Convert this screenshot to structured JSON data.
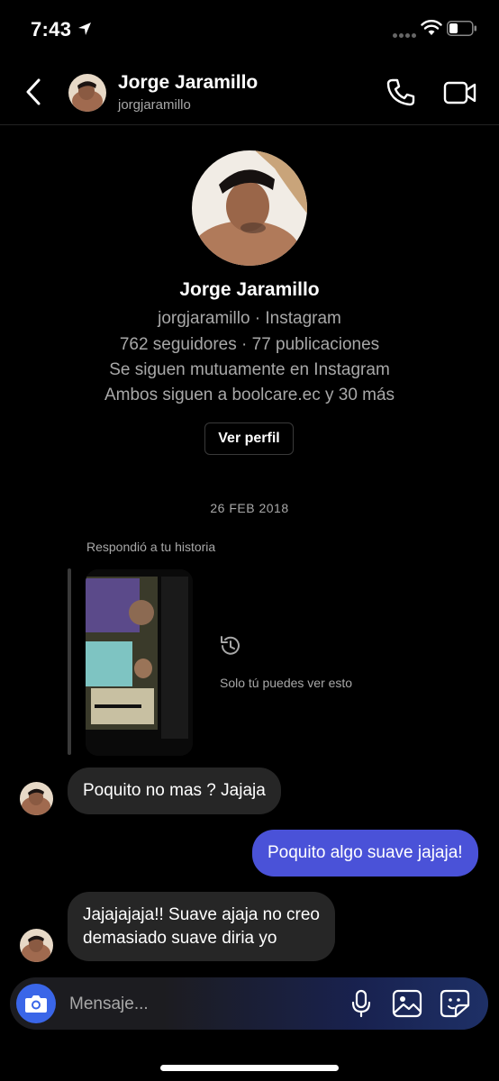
{
  "status_bar": {
    "time": "7:43"
  },
  "header": {
    "name": "Jorge Jaramillo",
    "username": "jorgjaramillo"
  },
  "profile": {
    "name": "Jorge Jaramillo",
    "line1": "jorgjaramillo · Instagram",
    "line2": "762 seguidores · 77 publicaciones",
    "line3": "Se siguen mutuamente en Instagram",
    "line4": "Ambos siguen a boolcare.ec y 30 más",
    "view_profile_label": "Ver perfil"
  },
  "thread": {
    "date": "26 FEB 2018",
    "story_reply_label": "Respondió a tu historia",
    "only_you_label": "Solo tú puedes ver esto",
    "messages": [
      {
        "text": "Poquito no mas ? Jajaja",
        "from": "them"
      },
      {
        "text": "Poquito algo suave jajaja!",
        "from": "me"
      },
      {
        "text": "Jajajajaja!! Suave ajaja no creo",
        "text2": "demasiado suave diria yo",
        "from": "them"
      }
    ]
  },
  "composer": {
    "placeholder": "Mensaje..."
  },
  "colors": {
    "outgoing_bubble": "#4a52d8",
    "incoming_bubble": "#262626",
    "camera_button": "#3a66e8"
  },
  "icons": [
    "back-icon",
    "call-icon",
    "video-call-icon",
    "history-icon",
    "camera-icon",
    "microphone-icon",
    "gallery-icon",
    "sticker-icon"
  ]
}
